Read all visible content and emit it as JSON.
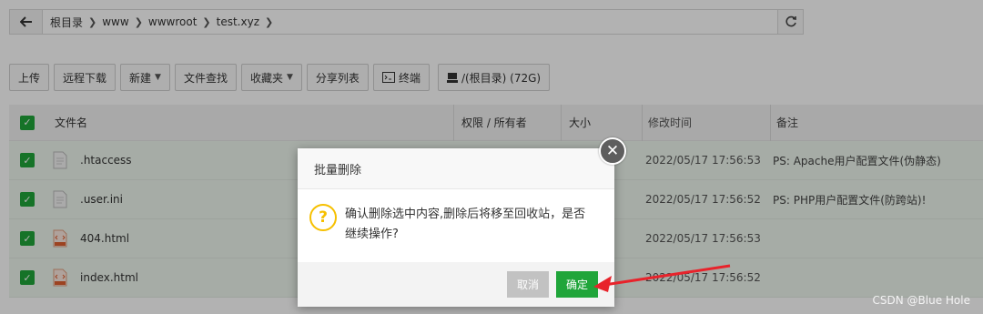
{
  "breadcrumb": {
    "items": [
      "根目录",
      "www",
      "wwwroot",
      "test.xyz"
    ]
  },
  "toolbar": {
    "upload": "上传",
    "remote_download": "远程下载",
    "new": "新建",
    "file_search": "文件查找",
    "favorites": "收藏夹",
    "share_list": "分享列表",
    "terminal": "终端",
    "disk": "/(根目录) (72G)"
  },
  "table": {
    "headers": {
      "name": "文件名",
      "perm": "权限 / 所有者",
      "size": "大小",
      "time": "修改时间",
      "note": "备注"
    },
    "rows": [
      {
        "name": ".htaccess",
        "time": "2022/05/17 17:56:53",
        "note": "PS: Apache用户配置文件(伪静态)"
      },
      {
        "name": ".user.ini",
        "time": "2022/05/17 17:56:52",
        "note": "PS: PHP用户配置文件(防跨站)!"
      },
      {
        "name": "404.html",
        "time": "2022/05/17 17:56:53",
        "note": ""
      },
      {
        "name": "index.html",
        "time": "2022/05/17 17:56:52",
        "note": ""
      }
    ]
  },
  "dialog": {
    "title": "批量删除",
    "message_line1": "确认删除选中内容,删除后将移至回收站，是否",
    "message_line2": "继续操作?",
    "cancel": "取消",
    "ok": "确定"
  },
  "watermark": "CSDN @Blue Hole",
  "colors": {
    "accent": "#20a53a",
    "warning": "#f6c000",
    "arrow": "#e8232b"
  }
}
